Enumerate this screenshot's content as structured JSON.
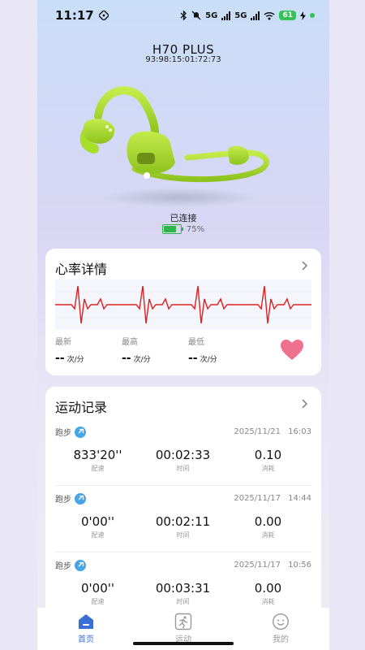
{
  "status_bar": {
    "time": "11:17",
    "net_5g_a": "5G",
    "net_5g_b": "5G",
    "battery": "61"
  },
  "device": {
    "name": "H70 PLUS",
    "mac": "93:98:15:01:72:73",
    "connection": "已连接",
    "battery_percent": "75%",
    "battery_level": 0.75,
    "color": "#a8dd2a"
  },
  "heart_rate": {
    "title": "心率详情",
    "stats": [
      {
        "label": "最新",
        "value": "--",
        "unit": "次/分"
      },
      {
        "label": "最高",
        "value": "--",
        "unit": "次/分"
      },
      {
        "label": "最低",
        "value": "--",
        "unit": "次/分"
      }
    ],
    "accent": "#f07090",
    "ecg_color": "#e02020"
  },
  "activity": {
    "title": "运动记录",
    "records": [
      {
        "type": "跑步",
        "date": "2025/11/21",
        "time": "16:03",
        "pace": "833'20''",
        "pace_label": "配速",
        "duration": "00:02:33",
        "duration_label": "时间",
        "calories": "0.10",
        "calories_label": "消耗"
      },
      {
        "type": "跑步",
        "date": "2025/11/17",
        "time": "14:44",
        "pace": "0'00''",
        "pace_label": "配速",
        "duration": "00:02:11",
        "duration_label": "时间",
        "calories": "0.00",
        "calories_label": "消耗"
      },
      {
        "type": "跑步",
        "date": "2025/11/17",
        "time": "10:56",
        "pace": "0'00''",
        "pace_label": "配速",
        "duration": "00:03:31",
        "duration_label": "时间",
        "calories": "0.00",
        "calories_label": "消耗"
      }
    ]
  },
  "tabs": [
    {
      "label": "首页",
      "icon": "home-icon",
      "active": true
    },
    {
      "label": "运动",
      "icon": "run-icon",
      "active": false
    },
    {
      "label": "我的",
      "icon": "profile-icon",
      "active": false
    }
  ],
  "colors": {
    "active_tab": "#3b6fd8",
    "link_badge": "#47a5e8",
    "battery_green": "#2fb54b"
  }
}
